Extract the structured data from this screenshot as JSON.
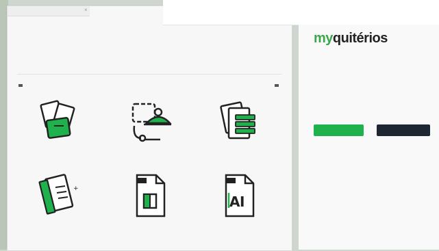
{
  "window": {
    "tab_title": "",
    "title": "",
    "lines": [
      "",
      "",
      "",
      ""
    ],
    "nav_left": "",
    "nav_right": ""
  },
  "tiles": [
    {
      "name": "",
      "desc": ""
    },
    {
      "name": "",
      "desc": ""
    },
    {
      "name": "",
      "desc": ""
    },
    {
      "name": "",
      "desc": ""
    },
    {
      "name": "",
      "desc": ""
    },
    {
      "name": "",
      "desc": ""
    }
  ],
  "topbar": {
    "items": [
      "",
      "",
      "",
      "",
      "",
      ""
    ]
  },
  "panel": {
    "logo_my": "my",
    "logo_rest": "quitérios",
    "label1": "",
    "label2": "",
    "label3": "",
    "option1": "",
    "option2": "",
    "button_green": "",
    "button_dark": "",
    "footer": [
      "",
      "",
      ""
    ]
  },
  "colors": {
    "accent": "#1fb14b",
    "dark": "#1f2633"
  }
}
